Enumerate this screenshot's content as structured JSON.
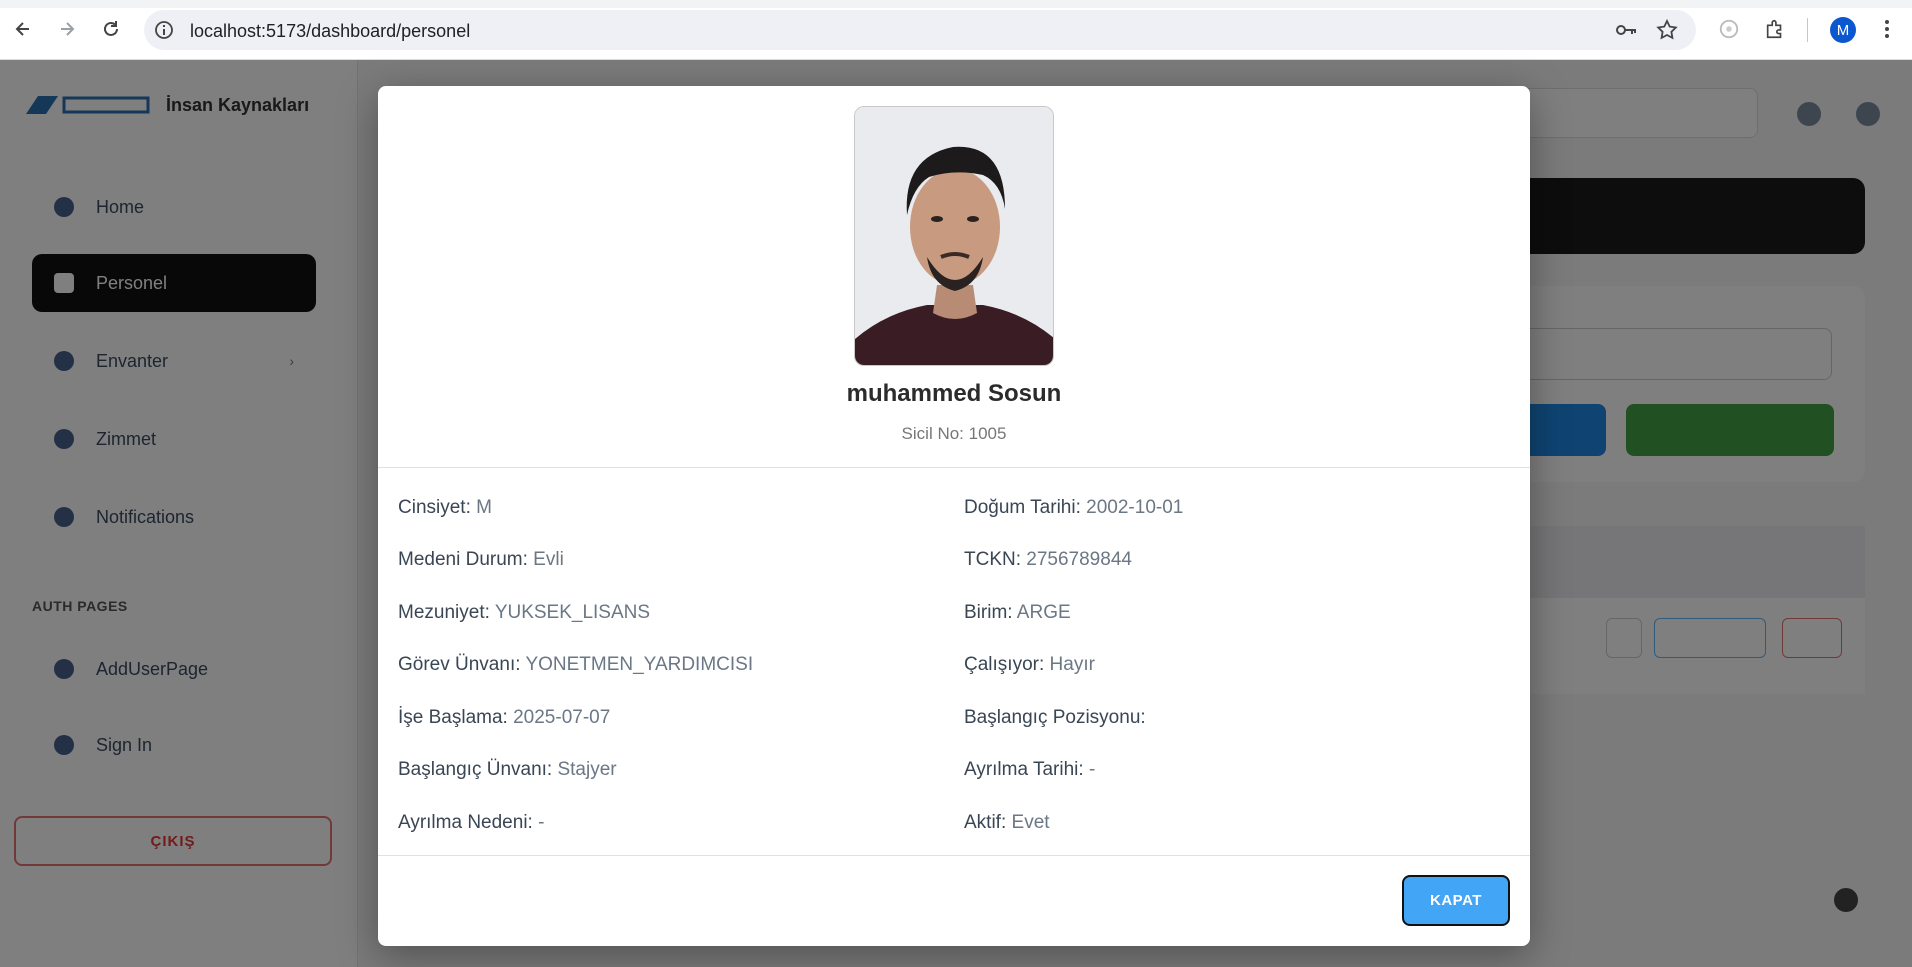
{
  "browser": {
    "url": "localhost:5173/dashboard/personel",
    "profile_initial": "M",
    "colors": {
      "accent": "#0b57d0"
    }
  },
  "app": {
    "brand_title": "İnsan Kaynakları",
    "sidebar": {
      "items": [
        {
          "label": "Home",
          "icon": "home-icon"
        },
        {
          "label": "Personel",
          "icon": "people-icon",
          "active": true
        },
        {
          "label": "Envanter",
          "icon": "inventory-icon",
          "has_children": true
        },
        {
          "label": "Zimmet",
          "icon": "assignment-icon"
        },
        {
          "label": "Notifications",
          "icon": "bell-icon"
        }
      ],
      "section_title": "AUTH PAGES",
      "auth_items": [
        {
          "label": "AddUserPage",
          "icon": "user-add-icon"
        },
        {
          "label": "Sign In",
          "icon": "sign-in-icon"
        }
      ],
      "logout_label": "ÇIKIŞ"
    }
  },
  "modal": {
    "name": "muhammed Sosun",
    "sicil": "Sicil No: 1005",
    "fields": [
      {
        "key": "Cinsiyet:",
        "value": "M"
      },
      {
        "key": "Doğum Tarihi:",
        "value": "2002-10-01"
      },
      {
        "key": "Medeni Durum:",
        "value": "Evli"
      },
      {
        "key": "TCKN:",
        "value": "2756789844"
      },
      {
        "key": "Mezuniyet:",
        "value": "YUKSEK_LISANS"
      },
      {
        "key": "Birim:",
        "value": "ARGE"
      },
      {
        "key": "Görev Ünvanı:",
        "value": "YONETMEN_YARDIMCISI"
      },
      {
        "key": "Çalışıyor:",
        "value": "Hayır"
      },
      {
        "key": "İşe Başlama:",
        "value": "2025-07-07"
      },
      {
        "key": "Başlangıç Pozisyonu:",
        "value": ""
      },
      {
        "key": "Başlangıç Ünvanı:",
        "value": "Stajyer"
      },
      {
        "key": "Ayrılma Tarihi:",
        "value": "-"
      },
      {
        "key": "Ayrılma Nedeni:",
        "value": "-"
      },
      {
        "key": "Aktif:",
        "value": "Evet"
      }
    ],
    "close_label": "KAPAT",
    "colors": {
      "close_button": "#42a5f5"
    }
  }
}
